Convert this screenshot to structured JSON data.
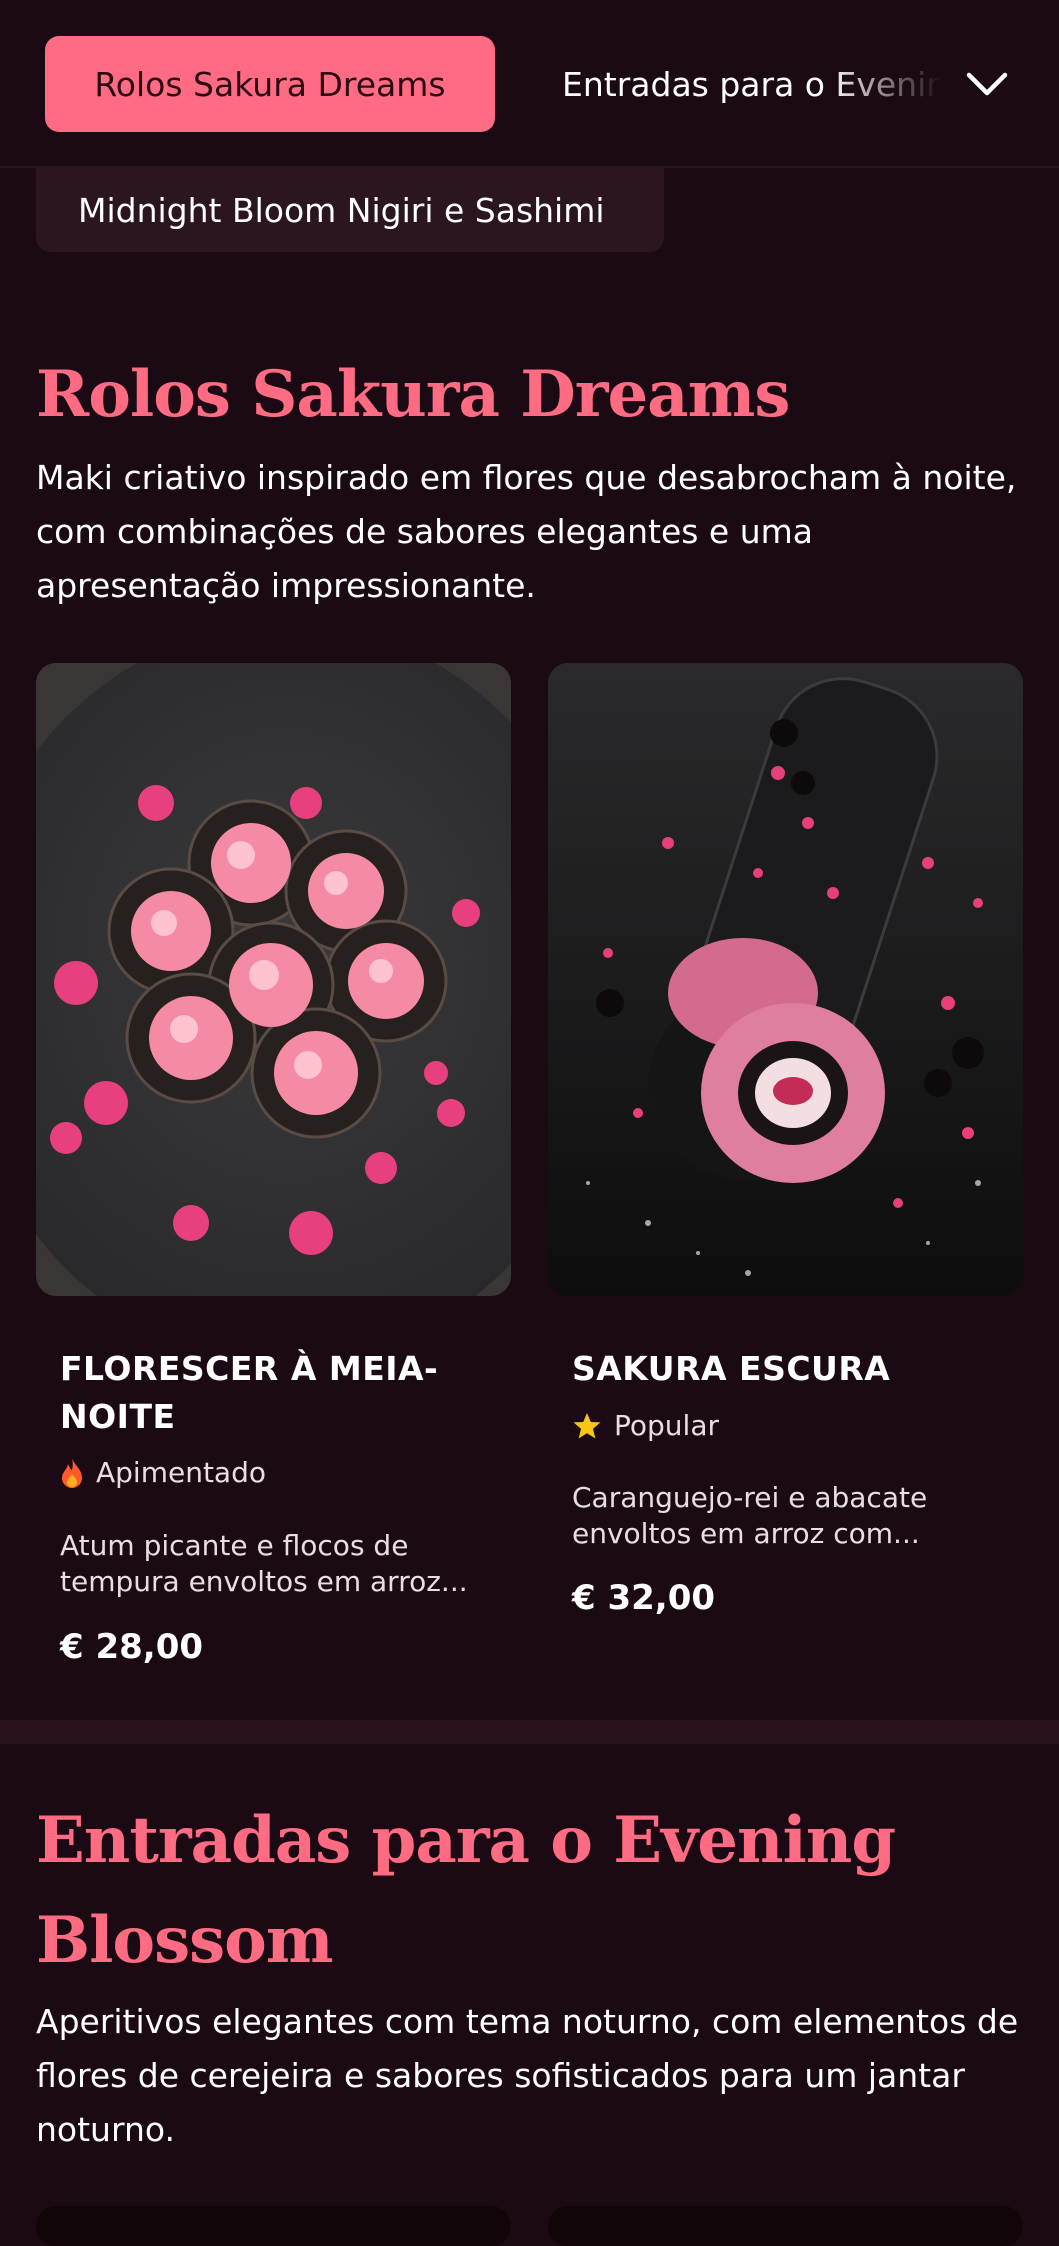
{
  "nav": {
    "active_tab": "Rolos Sakura Dreams",
    "next_tab": "Entradas para o Evening Blossom",
    "sub_tab": "Midnight Bloom Nigiri e Sashimi"
  },
  "sections": [
    {
      "title": "Rolos Sakura Dreams",
      "description": "Maki criativo inspirado em flores que desabrocham à noite, com combinações de sabores elegantes e uma apresentação impressionante.",
      "items": [
        {
          "name": "FLORESCER À MEIA-NOITE",
          "tag": "Apimentado",
          "tag_icon": "flame-icon",
          "description": "Atum picante e flocos de tempura envoltos em arroz...",
          "price": "€ 28,00"
        },
        {
          "name": "SAKURA ESCURA",
          "tag": "Popular",
          "tag_icon": "star-icon",
          "description": "Caranguejo-rei e abacate envoltos em arroz com...",
          "price": "€ 32,00"
        }
      ]
    },
    {
      "title": "Entradas para o Evening Blossom",
      "description": "Aperitivos elegantes com tema noturno, com elementos de flores de cerejeira e sabores sofisticados para um jantar noturno."
    }
  ],
  "colors": {
    "background": "#1b0a13",
    "accent": "#ff6b82",
    "chip": "#2a1520",
    "star": "#f5c518",
    "flame": "#ff5a2a"
  }
}
